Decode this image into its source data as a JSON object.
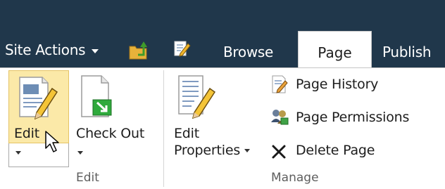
{
  "topbar": {
    "site_actions": "Site Actions",
    "tabs": [
      "Browse",
      "Page",
      "Publish"
    ]
  },
  "ribbon": {
    "edit_group": {
      "edit_label": "Edit",
      "check_out_label": "Check Out",
      "group_label": "Edit"
    },
    "manage_group": {
      "edit_properties_line1": "Edit",
      "edit_properties_line2": "Properties",
      "page_history": "Page History",
      "page_permissions": "Page Permissions",
      "delete_page": "Delete Page",
      "group_label": "Manage"
    }
  },
  "colors": {
    "topbar_bg": "#20374b",
    "selected_button_bg": "#fbe9a8"
  },
  "icons": [
    "navigate-up-icon",
    "edit-page-icon",
    "edit-document-icon",
    "check-out-icon",
    "edit-properties-icon",
    "page-history-icon",
    "page-permissions-icon",
    "delete-icon",
    "mouse-cursor-icon"
  ]
}
